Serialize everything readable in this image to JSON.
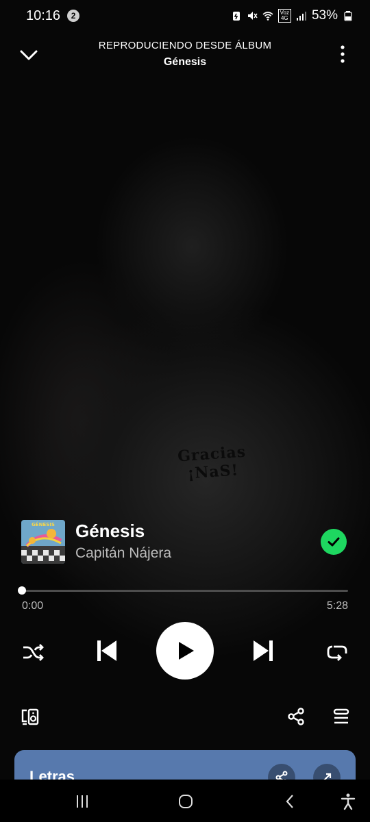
{
  "status_bar": {
    "time": "10:16",
    "notification_count": "2",
    "network_label_top": "Voz",
    "network_label_bottom": "4G",
    "battery": "53%"
  },
  "header": {
    "subtitle": "REPRODUCIENDO DESDE ÁLBUM",
    "title": "Génesis"
  },
  "background": {
    "shirt_text": "Gracias ¡NaS!"
  },
  "track": {
    "title": "Génesis",
    "artist": "Capitán Nájera",
    "liked": true,
    "art_text": "GÉNESIS"
  },
  "playback": {
    "elapsed": "0:00",
    "total": "5:28",
    "progress_fraction": 0.0
  },
  "controls": {
    "shuffle": "shuffle-icon",
    "previous": "skip-previous-icon",
    "play": "play-icon",
    "next": "skip-next-icon",
    "repeat": "repeat-icon"
  },
  "lyrics": {
    "label": "Letras"
  },
  "colors": {
    "accent_green": "#1ed760",
    "lyrics_card": "#5779ad"
  }
}
